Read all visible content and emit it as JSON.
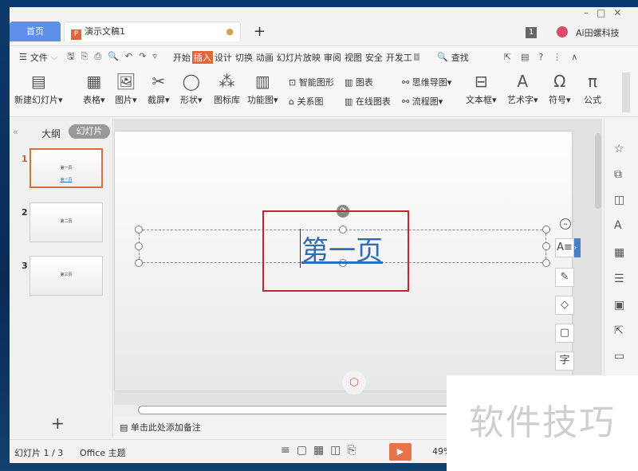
{
  "tabs": {
    "home": "首页",
    "doc": "演示文稿1",
    "new": "+"
  },
  "titlebar": {
    "badge": "1",
    "user": "Ai田螺科技"
  },
  "menu": {
    "file": "文件",
    "items": [
      "开始",
      "插入",
      "设计",
      "切换",
      "动画",
      "幻灯片放映",
      "审阅",
      "视图",
      "安全",
      "开发工"
    ],
    "active": "插入",
    "search": "查找"
  },
  "ribbon": {
    "new_slide": "新建幻灯片",
    "table": "表格",
    "picture": "图片",
    "screenshot": "截屏",
    "shape": "形状",
    "icon_lib": "图标库",
    "func_chart": "功能图",
    "smart_art": "智能图形",
    "relation": "关系图",
    "chart": "图表",
    "online_chart": "在线图表",
    "mindmap": "思维导图",
    "flowchart": "流程图",
    "textbox": "文本框",
    "wordart": "艺术字",
    "symbol": "符号",
    "formula": "公式"
  },
  "left_panel": {
    "outline": "大纲",
    "slides": "幻灯片",
    "thumbs": [
      {
        "num": "1",
        "title": "第一页",
        "sub": "第一页"
      },
      {
        "num": "2",
        "title": "第二页"
      },
      {
        "num": "3",
        "title": "第三页"
      }
    ],
    "add": "+"
  },
  "slide": {
    "text": "第一页"
  },
  "notes": {
    "placeholder": "单击此处添加备注"
  },
  "status": {
    "slide_count": "幻灯片 1 / 3",
    "theme": "Office 主题",
    "zoom": "49%"
  },
  "watermark": "软件技巧",
  "colors": {
    "accent": "#e0673a",
    "home_tab": "#5b8fe8",
    "selection": "#c0272d",
    "text": "#2e6db4"
  }
}
